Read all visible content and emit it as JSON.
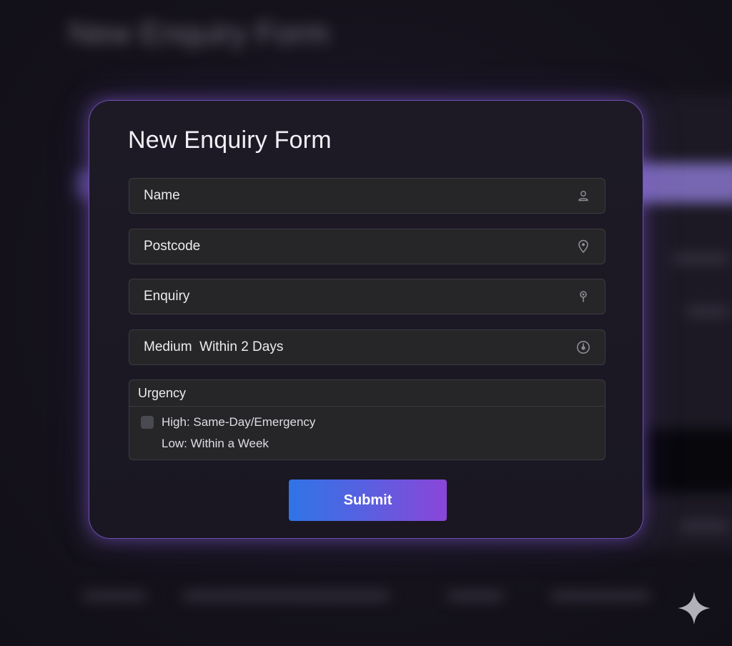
{
  "background": {
    "title": "New Enquiry Form"
  },
  "form": {
    "title": "New Enquiry Form",
    "fields": {
      "name": {
        "label": "Name",
        "icon": "user-icon"
      },
      "postcode": {
        "label": "Postcode",
        "icon": "map-pin-icon"
      },
      "enquiry": {
        "label": "Enquiry",
        "icon": "pin-icon"
      },
      "medium": {
        "label": "Medium  Within 2 Days",
        "icon": "clock-icon"
      }
    },
    "urgency": {
      "heading": "Urgency",
      "options": [
        {
          "label": "High: Same-Day/Emergency",
          "checked": false
        },
        {
          "label": "Low: Within a Week"
        }
      ]
    },
    "submit_label": "Submit"
  },
  "colors": {
    "accent_start": "#2f74e6",
    "accent_end": "#8a46d8",
    "card_border": "#6b4fb0",
    "field_bg": "#262629"
  },
  "watermark_icon": "sparkle-icon"
}
